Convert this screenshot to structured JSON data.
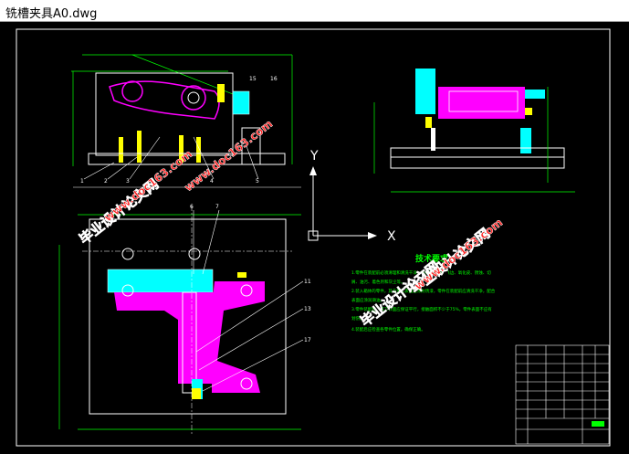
{
  "window": {
    "title": "铣槽夹具A0.dwg"
  },
  "drawing": {
    "watermarks": [
      {
        "text": "毕业设计论文网",
        "color": "#ff2020"
      },
      {
        "text": "www.doc163.com",
        "color": "#ff2020"
      },
      {
        "text": "毕业设计论文网",
        "color": "#ff2020"
      },
      {
        "text": "www.doc163.com",
        "color": "#ff2020"
      },
      {
        "text": "毕业设计论文网",
        "color": "#ff2020"
      },
      {
        "text": "www.doc163.com",
        "color": "#ff2020"
      }
    ],
    "ucs": {
      "y_label": "Y",
      "x_label": "X"
    },
    "tech_requirements": {
      "title": "技术要求",
      "lines": [
        "1.零件在装配前必须清理和清洗干净，不得有毛刺、飞边、氧化皮、锈蚀、切",
        "屑、油污、着色剂和灰尘等。",
        "2.装入箱体的零件，其未加工表面应涂防锈漆，零件在装配前应清洗干净，配合",
        "表面应涂润滑油。",
        "3.零件装配后，其工作面应保证平行，接触面积不少于75%，零件表面不应有",
        "划伤。",
        "4.装配后应检查各零件位置，确保正确。"
      ]
    },
    "balloons": [
      "1",
      "2",
      "3",
      "4",
      "5",
      "6",
      "7",
      "11",
      "13",
      "15",
      "16",
      "17"
    ],
    "colors": {
      "background": "#000000",
      "line": "#ffffff",
      "dimension": "#00ff00",
      "part": "#ff00ff",
      "accent": "#00ffff",
      "highlight": "#ffff00",
      "text": "#00ff00"
    }
  }
}
